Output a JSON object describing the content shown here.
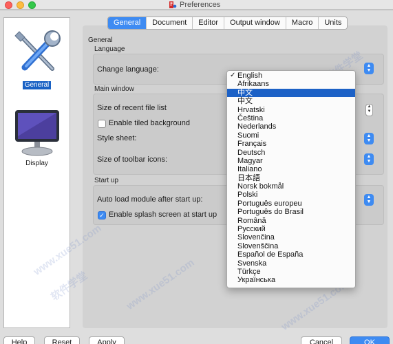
{
  "window": {
    "title": "Preferences"
  },
  "sidebar": {
    "items": [
      {
        "label": "General",
        "icon": "tools-icon",
        "selected": true
      },
      {
        "label": "Display",
        "icon": "monitor-icon",
        "selected": false
      }
    ]
  },
  "tabs": [
    {
      "label": "General",
      "active": true
    },
    {
      "label": "Document",
      "active": false
    },
    {
      "label": "Editor",
      "active": false
    },
    {
      "label": "Output window",
      "active": false
    },
    {
      "label": "Macro",
      "active": false
    },
    {
      "label": "Units",
      "active": false
    }
  ],
  "panel": {
    "title": "General",
    "language_group": {
      "label": "Language",
      "change_language_label": "Change language:"
    },
    "main_window_group": {
      "label": "Main window",
      "recent_files_label": "Size of recent file list",
      "tiled_background_label": "Enable tiled background",
      "tiled_background_checked": false,
      "style_sheet_label": "Style sheet:",
      "toolbar_icons_label": "Size of toolbar icons:"
    },
    "startup_group": {
      "label": "Start up",
      "autoload_label": "Auto load module after start up:",
      "splash_label": "Enable splash screen at start up",
      "splash_checked": true
    }
  },
  "language_dropdown": {
    "selected": "English",
    "highlighted": "中文",
    "options": [
      "English",
      "Afrikaans",
      "中文",
      "中文",
      "Hrvatski",
      "Čeština",
      "Nederlands",
      "Suomi",
      "Français",
      "Deutsch",
      "Magyar",
      "Italiano",
      "日本語",
      "Norsk bokmål",
      "Polski",
      "Português europeu",
      "Português do Brasil",
      "Română",
      "Русский",
      "Slovenčina",
      "Slovenščina",
      "Español de España",
      "Svenska",
      "Türkçe",
      "Українська"
    ]
  },
  "buttons": {
    "help": "Help",
    "reset": "Reset",
    "apply": "Apply",
    "cancel": "Cancel",
    "ok": "OK"
  },
  "watermarks": [
    "软件学堂",
    "www.xue51.com"
  ],
  "colors": {
    "accent": "#3e8bf2",
    "selection": "#1c61c6"
  }
}
